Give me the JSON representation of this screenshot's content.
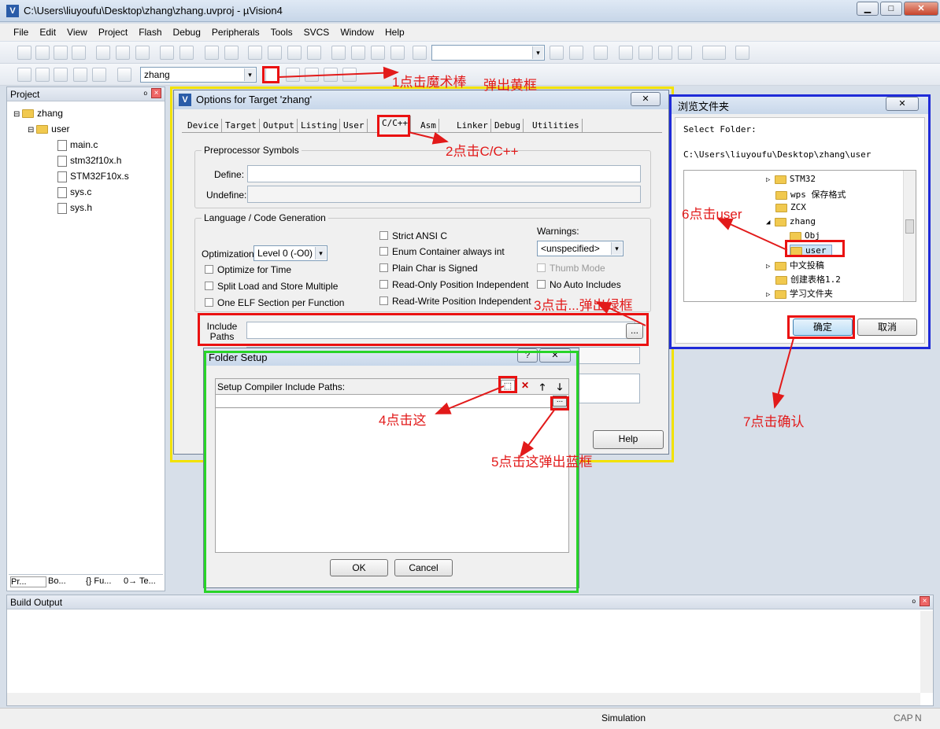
{
  "window": {
    "title": "C:\\Users\\liuyoufu\\Desktop\\zhang\\zhang.uvproj - µVision4",
    "minimize": "▁",
    "maximize": "□",
    "close": "✕"
  },
  "menu": [
    "File",
    "Edit",
    "View",
    "Project",
    "Flash",
    "Debug",
    "Peripherals",
    "Tools",
    "SVCS",
    "Window",
    "Help"
  ],
  "toolbar": {
    "target_select": "zhang",
    "dropdown_arrow": "▾"
  },
  "project_panel": {
    "title": "Project",
    "pin": "ᵒ",
    "close": "×",
    "root": "zhang",
    "group": "user",
    "files": [
      "main.c",
      "stm32f10x.h",
      "STM32F10x.s",
      "sys.c",
      "sys.h"
    ],
    "tabs": [
      "Pr...",
      "Bo...",
      "{} Fu...",
      "0→ Te..."
    ]
  },
  "options_dialog": {
    "title": "Options for Target 'zhang'",
    "close": "✕",
    "tabs": [
      "Device",
      "Target",
      "Output",
      "Listing",
      "User",
      "C/C++",
      "Asm",
      "Linker",
      "Debug",
      "Utilities"
    ],
    "preprocessor_label": "Preprocessor Symbols",
    "define_label": "Define:",
    "undefine_label": "Undefine:",
    "lang_label": "Language / Code Generation",
    "optimization_label": "Optimization:",
    "optimization_value": "Level 0 (-O0)",
    "optimize_time": "Optimize for Time",
    "split_load": "Split Load and Store Multiple",
    "one_elf": "One ELF Section per Function",
    "strict_ansi": "Strict ANSI C",
    "enum_container": "Enum Container always int",
    "plain_char": "Plain Char is Signed",
    "ropi": "Read-Only Position Independent",
    "rwpi": "Read-Write Position Independent",
    "warnings_label": "Warnings:",
    "warnings_value": "<unspecified>",
    "thumb_mode": "Thumb Mode",
    "no_auto_includes": "No Auto Includes",
    "include_paths_label": "Include\nPaths",
    "browse": "...",
    "help_button": "Help"
  },
  "folder_setup": {
    "title": "Folder Setup",
    "help": "?",
    "close": "✕",
    "list_label": "Setup Compiler Include Paths:",
    "new_icon": "⬚",
    "delete_icon": "✕",
    "up_icon": "🡑",
    "down_icon": "🡓",
    "browse": "...",
    "ok": "OK",
    "cancel": "Cancel"
  },
  "browse_dialog": {
    "title": "浏览文件夹",
    "close": "✕",
    "prompt": "Select Folder:",
    "path": "C:\\Users\\liuyoufu\\Desktop\\zhang\\user",
    "folders": [
      "STM32",
      "wps 保存格式",
      "ZCX",
      "zhang",
      "Obj",
      "user",
      "中文投稿",
      "创建表格1.2",
      "学习文件夹"
    ],
    "ok": "确定",
    "cancel": "取消"
  },
  "build_output": {
    "title": "Build Output",
    "pin": "ᵒ",
    "close": "×"
  },
  "status": {
    "mode": "Simulation",
    "caps": "CAP",
    "num": "N"
  },
  "annotations": [
    "1点击魔术棒",
    "弹出黄框",
    "2点击C/C++",
    "3点击...弹出绿框",
    "4点击这",
    "5点击这弹出蓝框",
    "6点击user",
    "7点击确认"
  ],
  "colors": {
    "yellow_frame": "#f2e200",
    "green_frame": "#28d428",
    "blue_frame": "#1f2bd8",
    "annotation_red": "#e21a1a"
  }
}
